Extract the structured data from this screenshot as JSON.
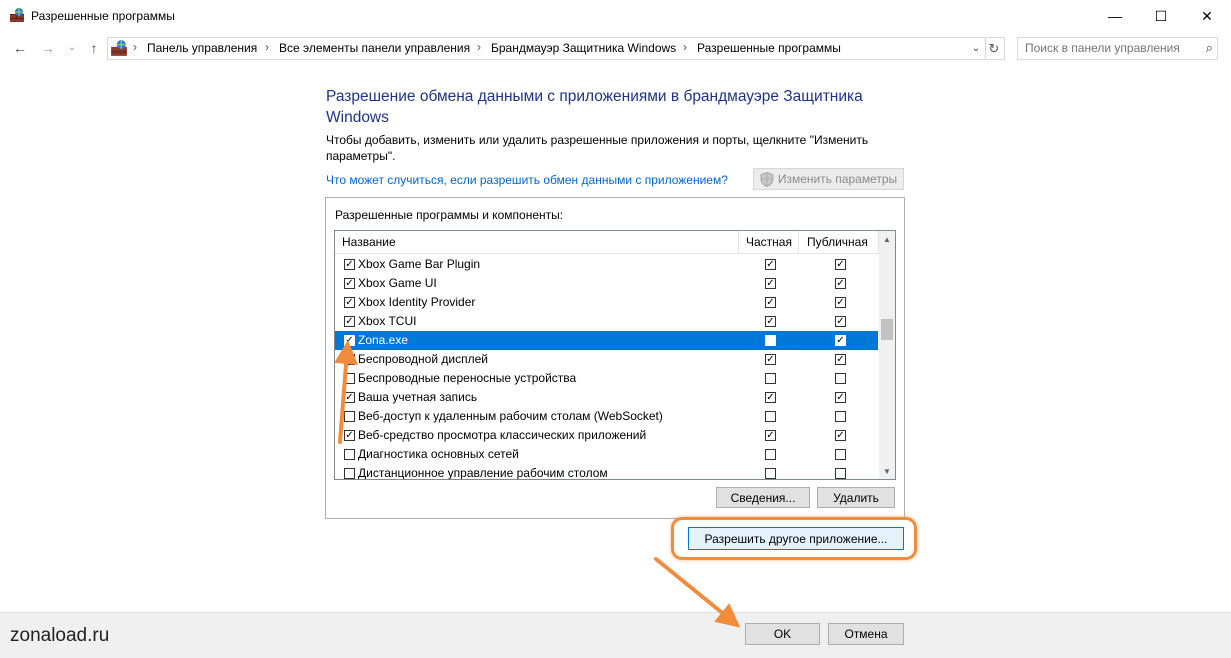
{
  "window": {
    "title": "Разрешенные программы",
    "minimize_glyph": "—",
    "maximize_glyph": "☐",
    "close_glyph": "✕"
  },
  "nav": {
    "back_glyph": "←",
    "forward_glyph": "→",
    "recent_glyph": "⌄",
    "up_glyph": "↑"
  },
  "address": {
    "crumbs": [
      "Панель управления",
      "Все элементы панели управления",
      "Брандмауэр Защитника Windows",
      "Разрешенные программы"
    ],
    "separator": "›",
    "dropdown_glyph": "⌄",
    "refresh_glyph": "↻"
  },
  "search": {
    "placeholder": "Поиск в панели управления",
    "icon_glyph": "⌕"
  },
  "content": {
    "heading": "Разрешение обмена данными с приложениями в брандмауэре Защитника Windows",
    "description": "Чтобы добавить, изменить или удалить разрешенные приложения и порты, щелкните \"Изменить параметры\".",
    "risk_link": "Что может случиться, если разрешить обмен данными с приложением?",
    "change_settings": "Изменить параметры",
    "group_label": "Разрешенные программы и компоненты:"
  },
  "list": {
    "columns": {
      "name": "Название",
      "private": "Частная",
      "public": "Публичная"
    },
    "check_glyph": "✓",
    "rows": [
      {
        "name": "Xbox Game Bar Plugin",
        "enabled": true,
        "private": true,
        "public": true,
        "selected": false
      },
      {
        "name": "Xbox Game UI",
        "enabled": true,
        "private": true,
        "public": true,
        "selected": false
      },
      {
        "name": "Xbox Identity Provider",
        "enabled": true,
        "private": true,
        "public": true,
        "selected": false
      },
      {
        "name": "Xbox TCUI",
        "enabled": true,
        "private": true,
        "public": true,
        "selected": false
      },
      {
        "name": "Zona.exe",
        "enabled": true,
        "private": false,
        "public": true,
        "selected": true
      },
      {
        "name": "Беспроводной дисплей",
        "enabled": true,
        "private": true,
        "public": true,
        "selected": false
      },
      {
        "name": "Беспроводные переносные устройства",
        "enabled": false,
        "private": false,
        "public": false,
        "selected": false
      },
      {
        "name": "Ваша учетная запись",
        "enabled": true,
        "private": true,
        "public": true,
        "selected": false
      },
      {
        "name": "Веб-доступ к удаленным рабочим столам (WebSocket)",
        "enabled": false,
        "private": false,
        "public": false,
        "selected": false
      },
      {
        "name": "Веб-средство просмотра классических приложений",
        "enabled": true,
        "private": true,
        "public": true,
        "selected": false
      },
      {
        "name": "Диагностика основных сетей",
        "enabled": false,
        "private": false,
        "public": false,
        "selected": false
      },
      {
        "name": "Дистанционное управление рабочим столом",
        "enabled": false,
        "private": false,
        "public": false,
        "selected": false
      }
    ],
    "scroll_up_glyph": "▲",
    "scroll_down_glyph": "▼"
  },
  "buttons": {
    "details": "Сведения...",
    "delete": "Удалить",
    "allow_other": "Разрешить другое приложение...",
    "ok": "OK",
    "cancel": "Отмена"
  },
  "watermark": "zonaload.ru",
  "colors": {
    "accent": "#0078d7",
    "heading": "#1e3287",
    "link": "#0066cc",
    "annotation": "#f08c3c"
  }
}
